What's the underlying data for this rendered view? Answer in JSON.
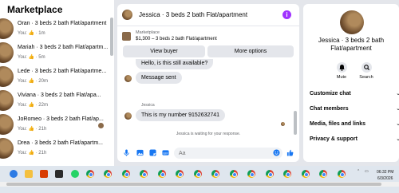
{
  "sidebar": {
    "title": "Marketplace",
    "conversations": [
      {
        "name": "Oran · 3 beds 2 bath Flat/apartment",
        "meta": "You: ",
        "time": " · 1m"
      },
      {
        "name": "Mariah · 3 beds 2 bath Flat/apartm...",
        "meta": "You: ",
        "time": " · 5m"
      },
      {
        "name": "Lede · 3 beds 2 bath Flat/apartme...",
        "meta": "You: ",
        "time": " · 20m"
      },
      {
        "name": "Viviana · 3 beds 2 bath Flat/apa...",
        "meta": "You: ",
        "time": " · 22m"
      },
      {
        "name": "JoRomeo · 3 beds 2 bath Flat/ap...",
        "meta": "You: ",
        "time": " · 21h"
      },
      {
        "name": "Drea · 3 beds 2 bath Flat/apartm...",
        "meta": "You: ",
        "time": " · 21h"
      }
    ]
  },
  "chat": {
    "title": "Jessica · 3 beds 2 bath Flat/apartment",
    "listing_label": "Marketplace",
    "listing_detail": "$1,300 – 3 beds 2 bath Flat/apartment",
    "view_buyer": "View buyer",
    "more_options": "More options",
    "messages": [
      "Hello, is this still available?",
      "Message sent",
      "This is my number 9152632741"
    ],
    "sender_name": "Jessica",
    "waiting": "Jessica is waiting for your response.",
    "composer_placeholder": "Aa"
  },
  "info": {
    "name": "Jessica · 3 beds 2 bath Flat/apartment",
    "mute": "Mute",
    "search": "Search",
    "sections": [
      "Customize chat",
      "Chat members",
      "Media, files and links",
      "Privacy & support"
    ]
  },
  "taskbar": {
    "time": "06:32 PM",
    "date": "6/3/2026"
  },
  "colors": {
    "accent": "#1877f2",
    "info_icon": "#a033ff"
  }
}
